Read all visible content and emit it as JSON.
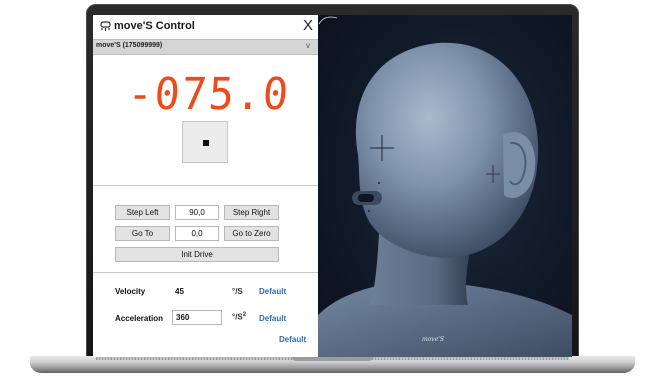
{
  "app": {
    "title": "move'S Control",
    "close": "X"
  },
  "device": {
    "selected": "move'S (175099999)",
    "chevron": "v"
  },
  "position_readout": "-075.0",
  "stop_button": "stop",
  "step": {
    "left_label": "Step Left",
    "value": "90,0",
    "right_label": "Step Right"
  },
  "goto": {
    "label": "Go To",
    "value": "0,0",
    "zero_label": "Go to Zero"
  },
  "init_label": "Init Drive",
  "velocity": {
    "label": "Velocity",
    "value": "45",
    "unit": "°/S",
    "default_label": "Default"
  },
  "acceleration": {
    "label": "Acceleration",
    "value": "360",
    "unit": "°/S",
    "unit_exp": "2",
    "default_label": "Default"
  },
  "reset_default_label": "Default",
  "viewport": {
    "logo_text": "move'S"
  },
  "colors": {
    "readout": "#ef4a1c",
    "link": "#2e6db4",
    "viewport_bg": "#111a28",
    "mannequin": "#8fa3bd"
  }
}
